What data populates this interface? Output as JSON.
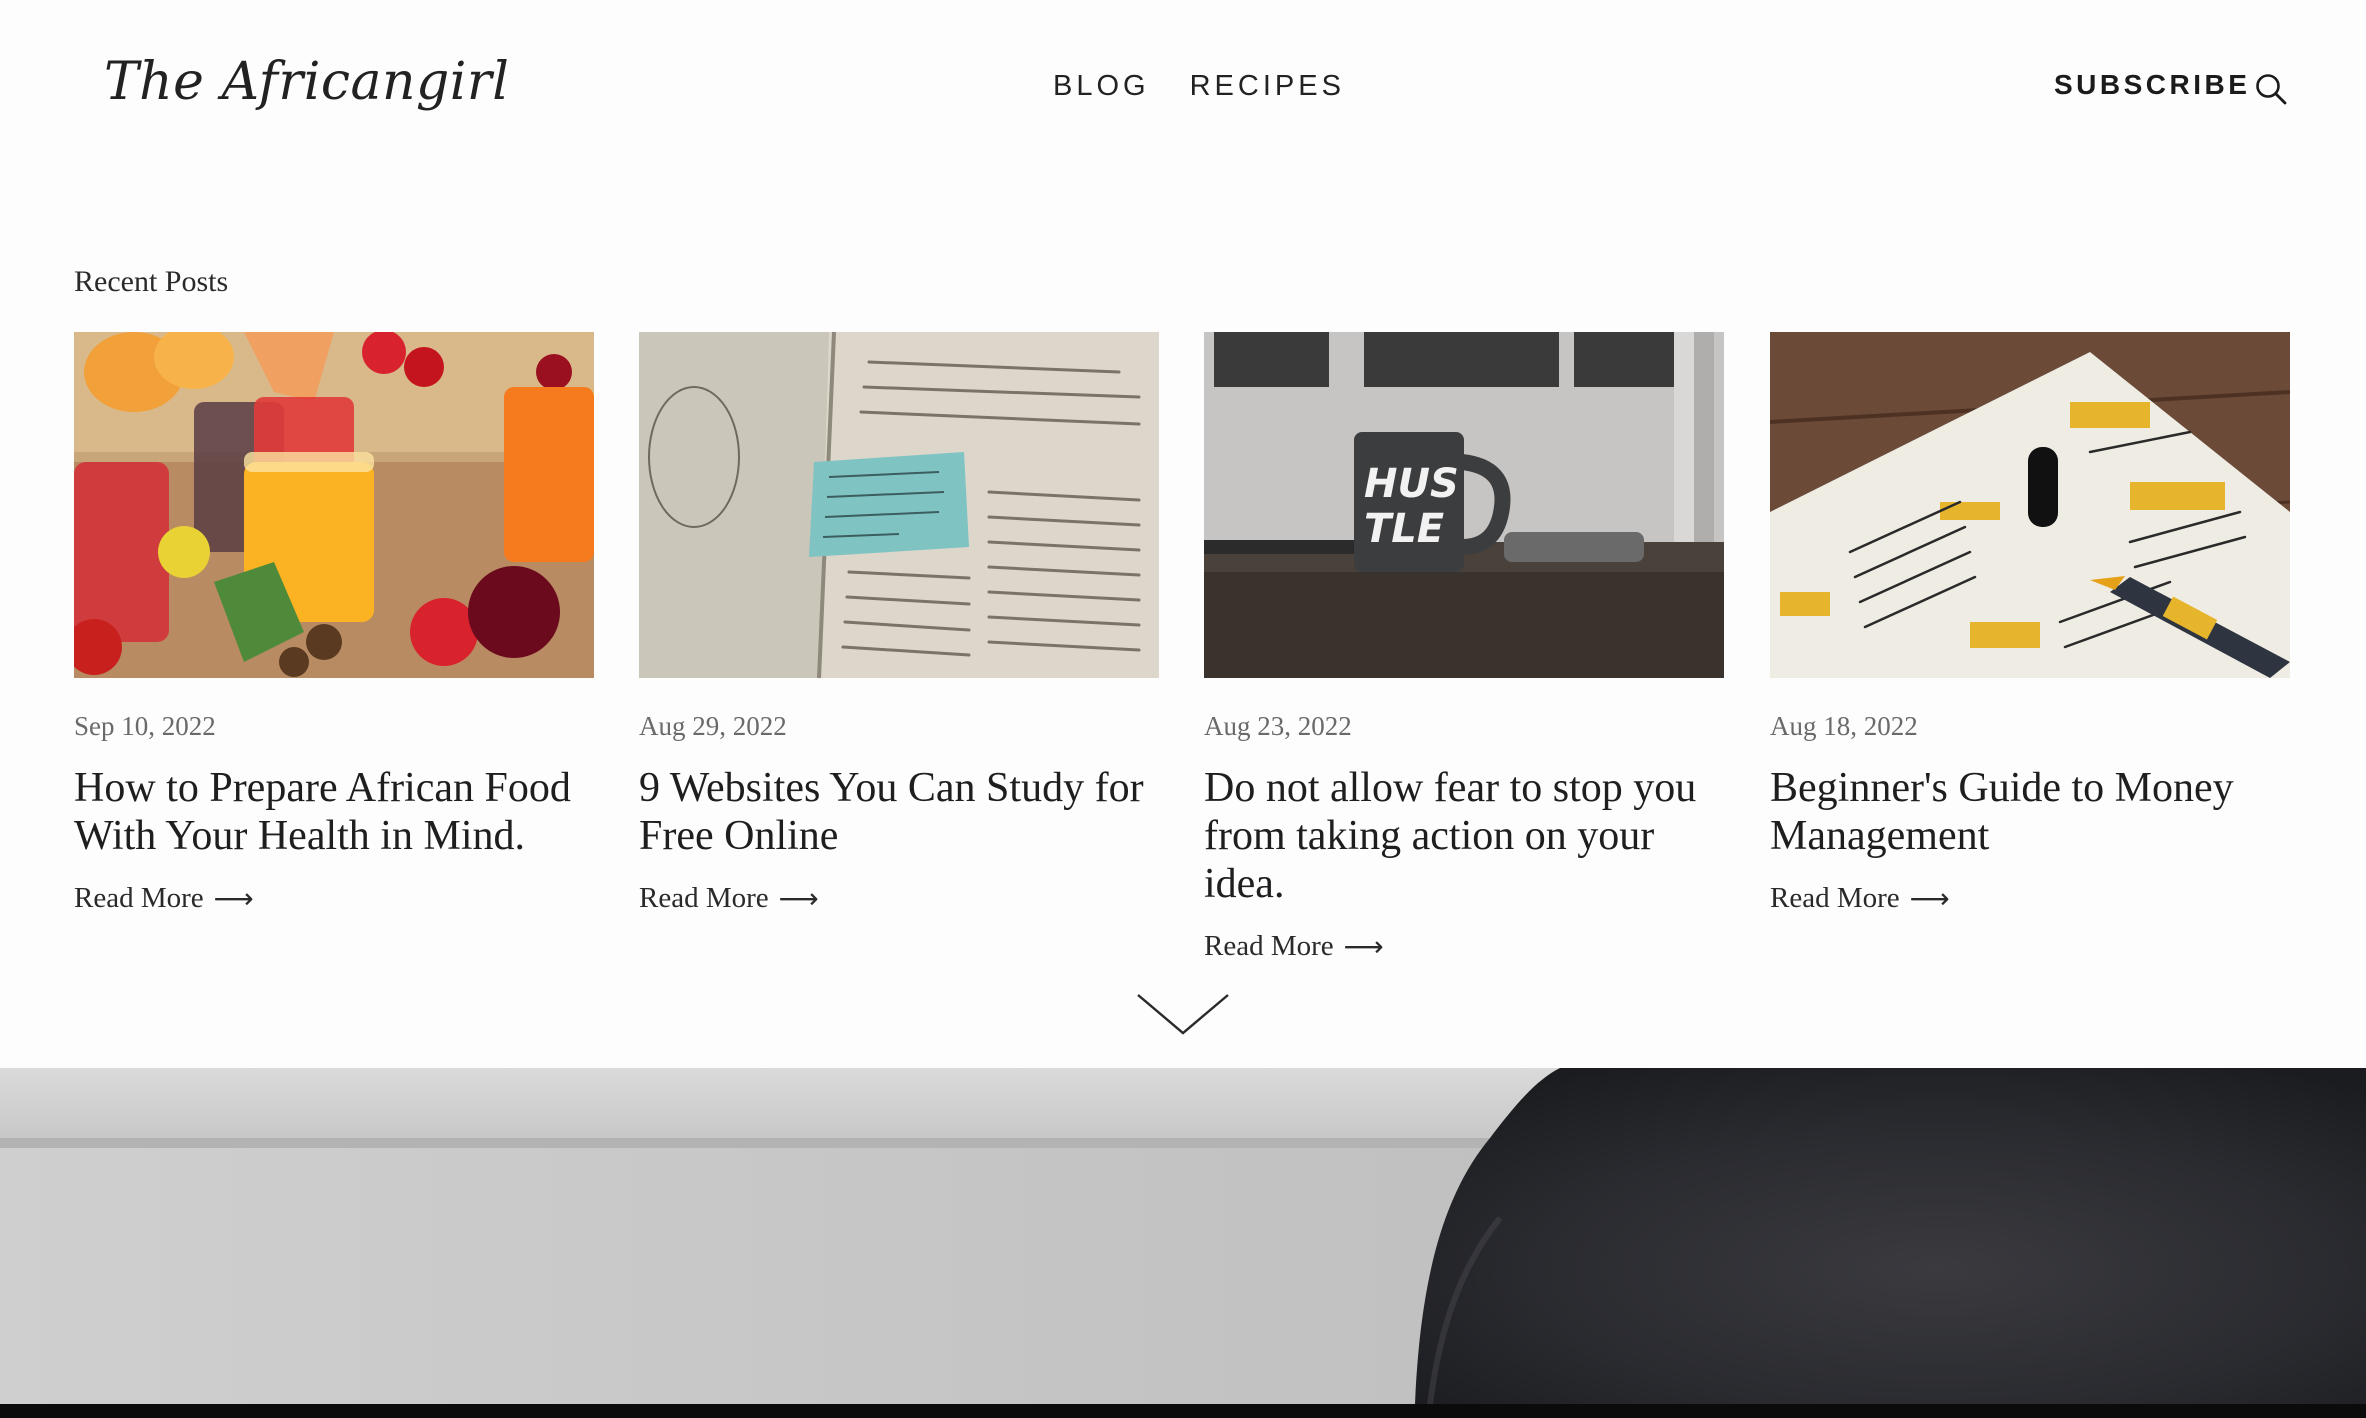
{
  "header": {
    "logo_text": "The Africangirl",
    "nav": [
      {
        "label": "BLOG"
      },
      {
        "label": "RECIPES"
      }
    ],
    "subscribe_label": "SUBSCRIBE",
    "search_icon": "search-icon"
  },
  "recent_posts": {
    "heading": "Recent Posts",
    "read_more_label": "Read More",
    "posts": [
      {
        "date": "Sep 10, 2022",
        "title": "How to Prepare African Food With Your Health in Mind.",
        "image": "fruit-juices-photo"
      },
      {
        "date": "Aug 29, 2022",
        "title": "9 Websites You Can Study for Free Online",
        "image": "open-book-sticky-note-photo"
      },
      {
        "date": "Aug 23, 2022",
        "title": "Do not allow fear to stop you from taking action on your idea.",
        "image": "hustle-mug-photo"
      },
      {
        "date": "Aug 18, 2022",
        "title": "Beginner's Guide to Money Management",
        "image": "notebook-doodles-photo"
      }
    ]
  },
  "scroll_icon": "chevron-down-icon",
  "hero_image": "woman-hair-photo"
}
